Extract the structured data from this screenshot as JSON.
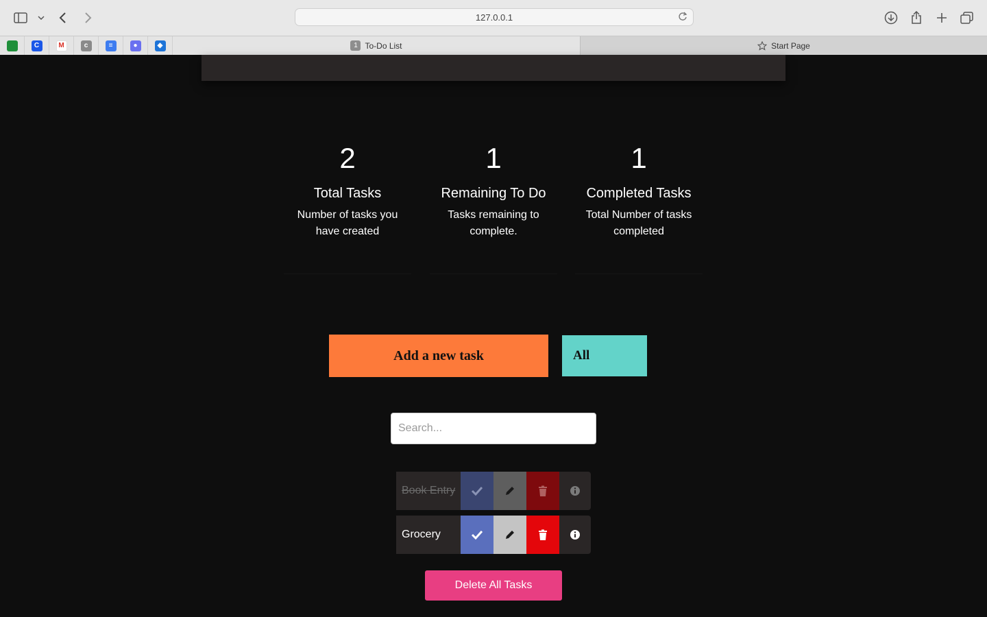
{
  "browser": {
    "url": "127.0.0.1",
    "tabs": [
      {
        "label": "To-Do List",
        "badge": "1",
        "active": true
      },
      {
        "label": "Start Page",
        "active": false
      }
    ],
    "favorites": [
      {
        "icon": "photos-icon",
        "color": "#1f8f3a",
        "glyph": ""
      },
      {
        "icon": "c-app-icon",
        "color": "#1a57e8",
        "glyph": "C"
      },
      {
        "icon": "gmail-icon",
        "color": "#ffffff",
        "glyph": "M"
      },
      {
        "icon": "c-gray-icon",
        "color": "#8a8a8a",
        "glyph": "c"
      },
      {
        "icon": "docs-icon",
        "color": "#3d7cf0",
        "glyph": "≡"
      },
      {
        "icon": "discord-icon",
        "color": "#6a70f0",
        "glyph": "●"
      },
      {
        "icon": "codepen-icon",
        "color": "#1d74d8",
        "glyph": "◆"
      }
    ]
  },
  "stats": [
    {
      "value": "2",
      "title": "Total Tasks",
      "description": "Number of tasks you have created"
    },
    {
      "value": "1",
      "title": "Remaining To Do",
      "description": "Tasks remaining to complete."
    },
    {
      "value": "1",
      "title": "Completed Tasks",
      "description": "Total Number of tasks completed"
    }
  ],
  "controls": {
    "add_label": "Add a new task",
    "filter_label": "All",
    "search_placeholder": "Search..."
  },
  "tasks": [
    {
      "name": "Book Entry",
      "completed": true
    },
    {
      "name": "Grocery",
      "completed": false
    }
  ],
  "delete_all_label": "Delete All Tasks",
  "colors": {
    "add": "#fd7a3a",
    "filter": "#63d3c9",
    "complete": "#5a6fbd",
    "complete_dim": "#3a4570",
    "edit": "#c4c4c4",
    "edit_dim": "#5e5e5e",
    "delete": "#e4060b",
    "delete_dim": "#7e0a0d",
    "delete_all": "#e83e82"
  }
}
